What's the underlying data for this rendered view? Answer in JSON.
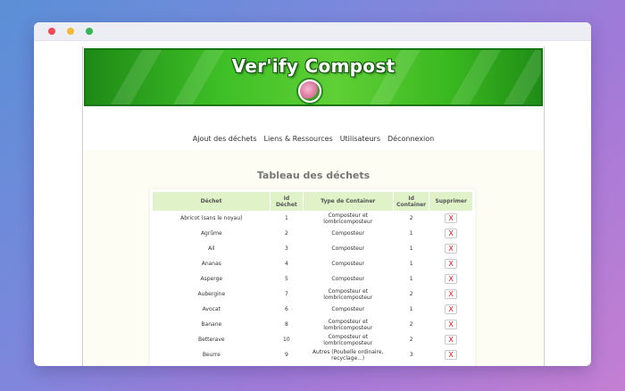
{
  "header": {
    "title": "Ver'ify Compost"
  },
  "nav": {
    "items": [
      "Ajout des déchets",
      "Liens & Ressources",
      "Utilisateurs",
      "Déconnexion"
    ]
  },
  "main": {
    "table_title": "Tableau des déchets",
    "columns": [
      "Déchet",
      "Id Déchet",
      "Type de Container",
      "Id Container",
      "Supprimer"
    ],
    "rows": [
      {
        "dechet": "Abricot (sans le noyau)",
        "id_dechet": "1",
        "type": "Composteur et lombricomposteur",
        "id_container": "2"
      },
      {
        "dechet": "Agrûme",
        "id_dechet": "2",
        "type": "Composteur",
        "id_container": "1"
      },
      {
        "dechet": "Ail",
        "id_dechet": "3",
        "type": "Composteur",
        "id_container": "1"
      },
      {
        "dechet": "Ananas",
        "id_dechet": "4",
        "type": "Composteur",
        "id_container": "1"
      },
      {
        "dechet": "Asperge",
        "id_dechet": "5",
        "type": "Composteur",
        "id_container": "1"
      },
      {
        "dechet": "Aubergine",
        "id_dechet": "7",
        "type": "Composteur et lombricomposteur",
        "id_container": "2"
      },
      {
        "dechet": "Avocat",
        "id_dechet": "6",
        "type": "Composteur",
        "id_container": "1"
      },
      {
        "dechet": "Banane",
        "id_dechet": "8",
        "type": "Composteur et lombricomposteur",
        "id_container": "2"
      },
      {
        "dechet": "Betterave",
        "id_dechet": "10",
        "type": "Composteur et lombricomposteur",
        "id_container": "2"
      },
      {
        "dechet": "Beurre",
        "id_dechet": "9",
        "type": "Autres (Poubelle ordinaire, recyclage...)",
        "id_container": "3"
      }
    ],
    "delete_label": "X"
  },
  "colors": {
    "brand_green": "#3fbf26",
    "header_row": "#dff2c8",
    "delete_red": "#e0141e"
  }
}
